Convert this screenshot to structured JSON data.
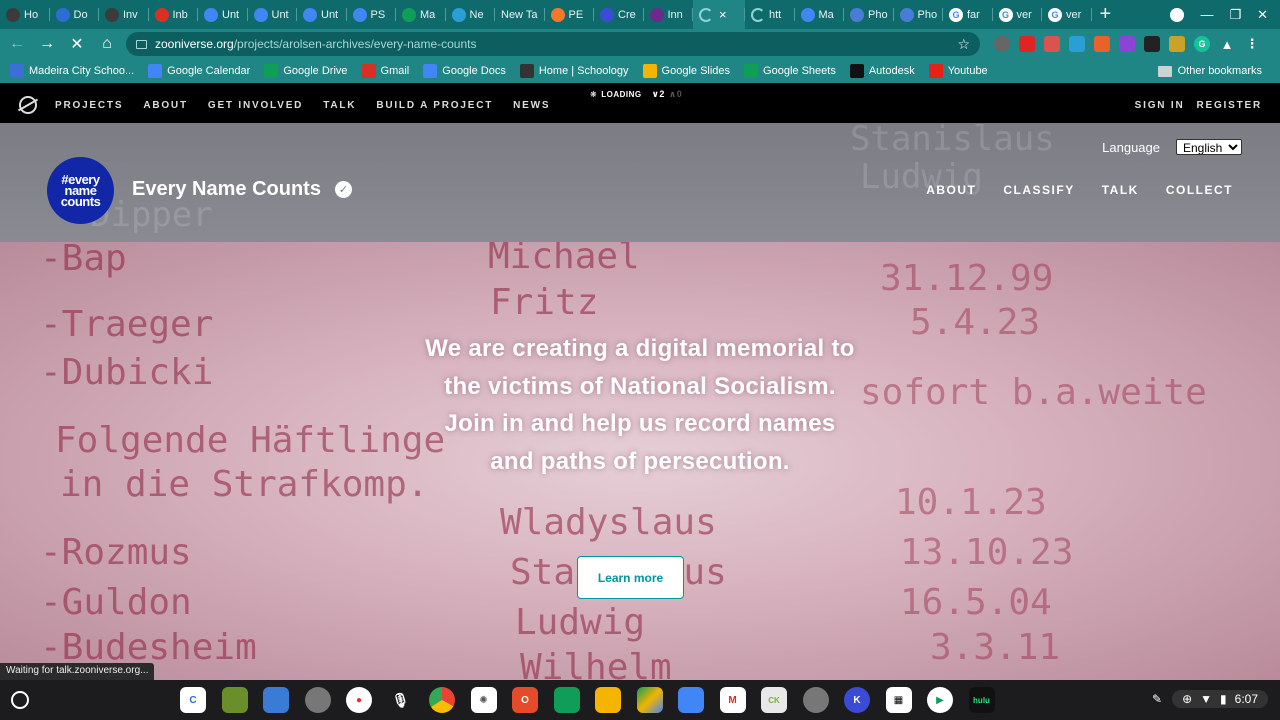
{
  "browser": {
    "tabs": [
      {
        "label": "Ho",
        "icon": "sparkle-icon",
        "color": "#3b3b3b"
      },
      {
        "label": "Do",
        "icon": "p-icon",
        "color": "#2e6cd6"
      },
      {
        "label": "Inv",
        "icon": "sparkle-icon",
        "color": "#3b3b3b"
      },
      {
        "label": "Inb",
        "icon": "gmail-icon",
        "color": "#d93025"
      },
      {
        "label": "Unt",
        "icon": "docs-icon",
        "color": "#4285f4"
      },
      {
        "label": "Unt",
        "icon": "docs-icon",
        "color": "#4285f4"
      },
      {
        "label": "Unt",
        "icon": "docs-icon",
        "color": "#4285f4"
      },
      {
        "label": "PS",
        "icon": "docs-icon",
        "color": "#4285f4"
      },
      {
        "label": "Ma",
        "icon": "sheets-icon",
        "color": "#0f9d58"
      },
      {
        "label": "Ne",
        "icon": "edge-icon",
        "color": "#2a9fd6"
      },
      {
        "label": "New Ta",
        "icon": "",
        "color": ""
      },
      {
        "label": "PE",
        "icon": "play-icon",
        "color": "#f4772c"
      },
      {
        "label": "Cre",
        "icon": "circle-icon",
        "color": "#3c4bd6"
      },
      {
        "label": "Inn",
        "icon": "zooniverse-icon",
        "color": "#6b2a8c"
      },
      {
        "label": "",
        "icon": "loading-icon",
        "color": ""
      },
      {
        "label": "htt",
        "icon": "loading-icon",
        "color": ""
      },
      {
        "label": "Ma",
        "icon": "calendar-icon",
        "color": "#4285f4"
      },
      {
        "label": "Pho",
        "icon": "wave-icon",
        "color": "#4a7bd6"
      },
      {
        "label": "Pho",
        "icon": "wave-icon",
        "color": "#4a7bd6"
      },
      {
        "label": "far",
        "icon": "google-icon",
        "color": "#ffffff"
      },
      {
        "label": "ver",
        "icon": "google-icon",
        "color": "#ffffff"
      },
      {
        "label": "ver",
        "icon": "google-icon",
        "color": "#ffffff"
      }
    ],
    "url_host": "zooniverse.org",
    "url_path": "/projects/arolsen-archives/every-name-counts",
    "bookmarks": [
      {
        "label": "Madeira City Schoo...",
        "color": "#3b6fd6"
      },
      {
        "label": "Google Calendar",
        "color": "#4285f4"
      },
      {
        "label": "Google Drive",
        "color": "#0f9d58"
      },
      {
        "label": "Gmail",
        "color": "#d93025"
      },
      {
        "label": "Google Docs",
        "color": "#4285f4"
      },
      {
        "label": "Home | Schoology",
        "color": "#333333"
      },
      {
        "label": "Google Slides",
        "color": "#f4b400"
      },
      {
        "label": "Google Sheets",
        "color": "#0f9d58"
      },
      {
        "label": "Autodesk",
        "color": "#111111"
      },
      {
        "label": "Youtube",
        "color": "#e62117"
      }
    ],
    "other_bookmarks": "Other bookmarks",
    "status_text": "Waiting for talk.zooniverse.org..."
  },
  "zooniverse_nav": {
    "items": [
      "PROJECTS",
      "ABOUT",
      "GET INVOLVED",
      "TALK",
      "BUILD A PROJECT",
      "NEWS"
    ],
    "loading": "LOADING",
    "count_down": "2",
    "count_up": "0",
    "sign_in": "SIGN IN",
    "register": "REGISTER"
  },
  "project": {
    "logo_lines": [
      "#every",
      "name",
      "counts"
    ],
    "title": "Every Name Counts",
    "language_label": "Language",
    "language_value": "English",
    "nav": [
      "ABOUT",
      "CLASSIFY",
      "TALK",
      "COLLECT"
    ]
  },
  "hero": {
    "text": "We are creating a digital memorial to the victims of National Socialism. Join in and help us record names and paths of persecution.",
    "button": "Learn more"
  },
  "shelf": {
    "time": "6:07"
  }
}
